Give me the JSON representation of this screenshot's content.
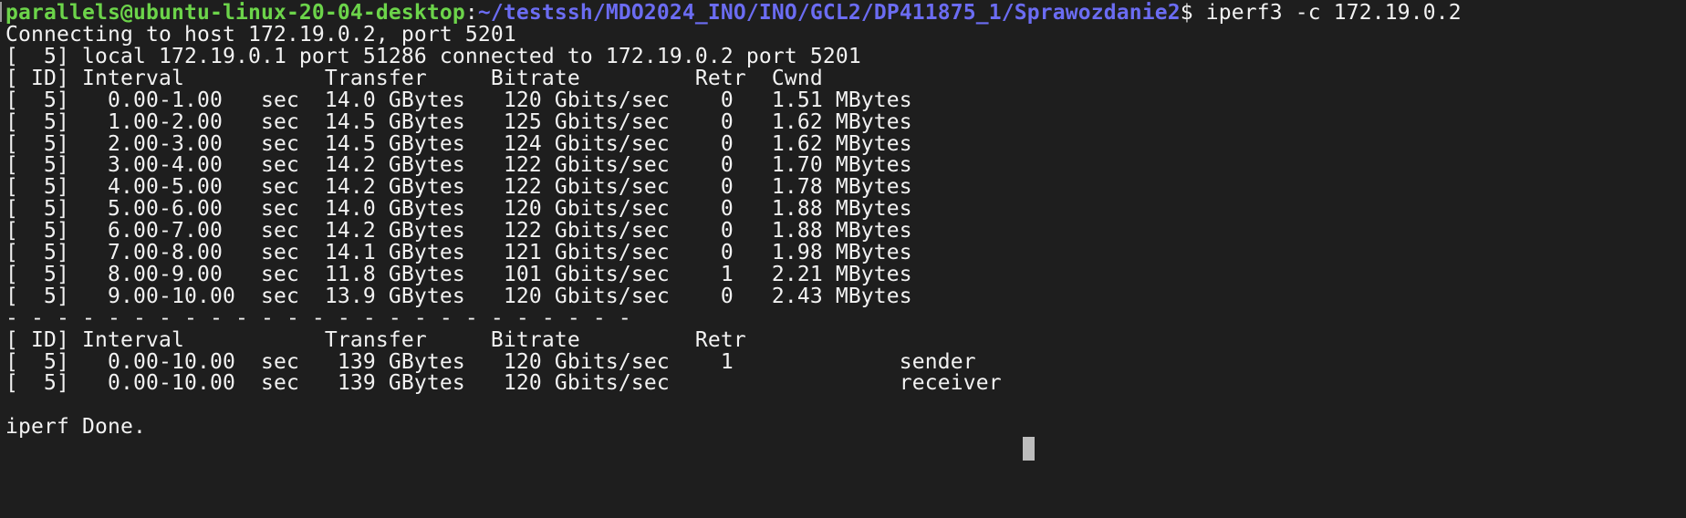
{
  "prompt": {
    "user_host": "parallels@ubuntu-linux-20-04-desktop",
    "separator": ":",
    "path": "~/testssh/MDO2024_INO/INO/GCL2/DP411875_1/Sprawozdanie2",
    "dollar": "$ ",
    "command": "iperf3 -c 172.19.0.2"
  },
  "output": {
    "lines": [
      "Connecting to host 172.19.0.2, port 5201",
      "[  5] local 172.19.0.1 port 51286 connected to 172.19.0.2 port 5201",
      "[ ID] Interval           Transfer     Bitrate         Retr  Cwnd",
      "[  5]   0.00-1.00   sec  14.0 GBytes   120 Gbits/sec    0   1.51 MBytes",
      "[  5]   1.00-2.00   sec  14.5 GBytes   125 Gbits/sec    0   1.62 MBytes",
      "[  5]   2.00-3.00   sec  14.5 GBytes   124 Gbits/sec    0   1.62 MBytes",
      "[  5]   3.00-4.00   sec  14.2 GBytes   122 Gbits/sec    0   1.70 MBytes",
      "[  5]   4.00-5.00   sec  14.2 GBytes   122 Gbits/sec    0   1.78 MBytes",
      "[  5]   5.00-6.00   sec  14.0 GBytes   120 Gbits/sec    0   1.88 MBytes",
      "[  5]   6.00-7.00   sec  14.2 GBytes   122 Gbits/sec    0   1.88 MBytes",
      "[  5]   7.00-8.00   sec  14.1 GBytes   121 Gbits/sec    0   1.98 MBytes",
      "[  5]   8.00-9.00   sec  11.8 GBytes   101 Gbits/sec    1   2.21 MBytes",
      "[  5]   9.00-10.00  sec  13.9 GBytes   120 Gbits/sec    0   2.43 MBytes",
      "- - - - - - - - - - - - - - - - - - - - - - - - -",
      "[ ID] Interval           Transfer     Bitrate         Retr",
      "[  5]   0.00-10.00  sec   139 GBytes   120 Gbits/sec    1             sender",
      "[  5]   0.00-10.00  sec   139 GBytes   120 Gbits/sec                  receiver",
      "",
      "iperf Done."
    ]
  },
  "colors": {
    "background": "#1e1e1e",
    "text": "#f2f2f2",
    "prompt_user": "#6cd44a",
    "prompt_path": "#6b6cf2",
    "cursor": "#bdbdbd"
  }
}
